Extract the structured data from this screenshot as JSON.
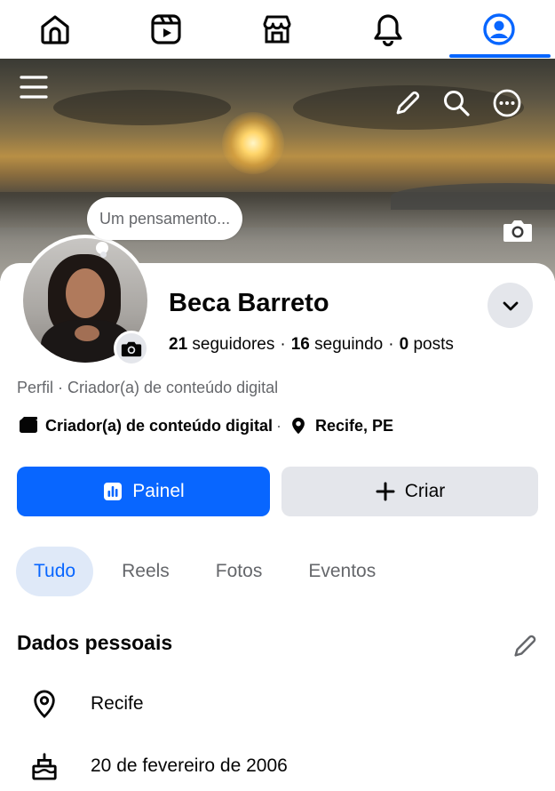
{
  "nav": {
    "items": [
      {
        "name": "home",
        "icon": "home-icon"
      },
      {
        "name": "reels",
        "icon": "reels-icon"
      },
      {
        "name": "marketplace",
        "icon": "marketplace-icon"
      },
      {
        "name": "notifications",
        "icon": "bell-icon"
      },
      {
        "name": "profile",
        "icon": "profile-icon",
        "active": true
      }
    ],
    "accent": "#0866ff"
  },
  "cover": {
    "menu_icon": "hamburger-menu-icon",
    "actions": [
      "pencil-icon",
      "search-icon",
      "more-options-icon"
    ],
    "camera_icon": "camera-icon"
  },
  "thought_bubble": {
    "placeholder": "Um pensamento..."
  },
  "profile": {
    "name": "Beca Barreto",
    "followers_count": "21",
    "followers_label": "seguidores",
    "following_count": "16",
    "following_label": "seguindo",
    "posts_count": "0",
    "posts_label": "posts",
    "subtitle": "Perfil · Criador(a) de conteúdo digital",
    "category": "Criador(a) de conteúdo digital",
    "location": "Recife, PE"
  },
  "actions": {
    "primary_label": "Painel",
    "secondary_label": "Criar"
  },
  "tabs": [
    {
      "label": "Tudo",
      "active": true
    },
    {
      "label": "Reels"
    },
    {
      "label": "Fotos"
    },
    {
      "label": "Eventos"
    }
  ],
  "personal_info": {
    "title": "Dados pessoais",
    "city": "Recife",
    "birthday": "20 de fevereiro de 2006"
  },
  "colors": {
    "primary": "#0866ff",
    "secondary_bg": "#e4e6eb",
    "active_tab_bg": "#dfe9f8",
    "muted_text": "#65676b"
  }
}
